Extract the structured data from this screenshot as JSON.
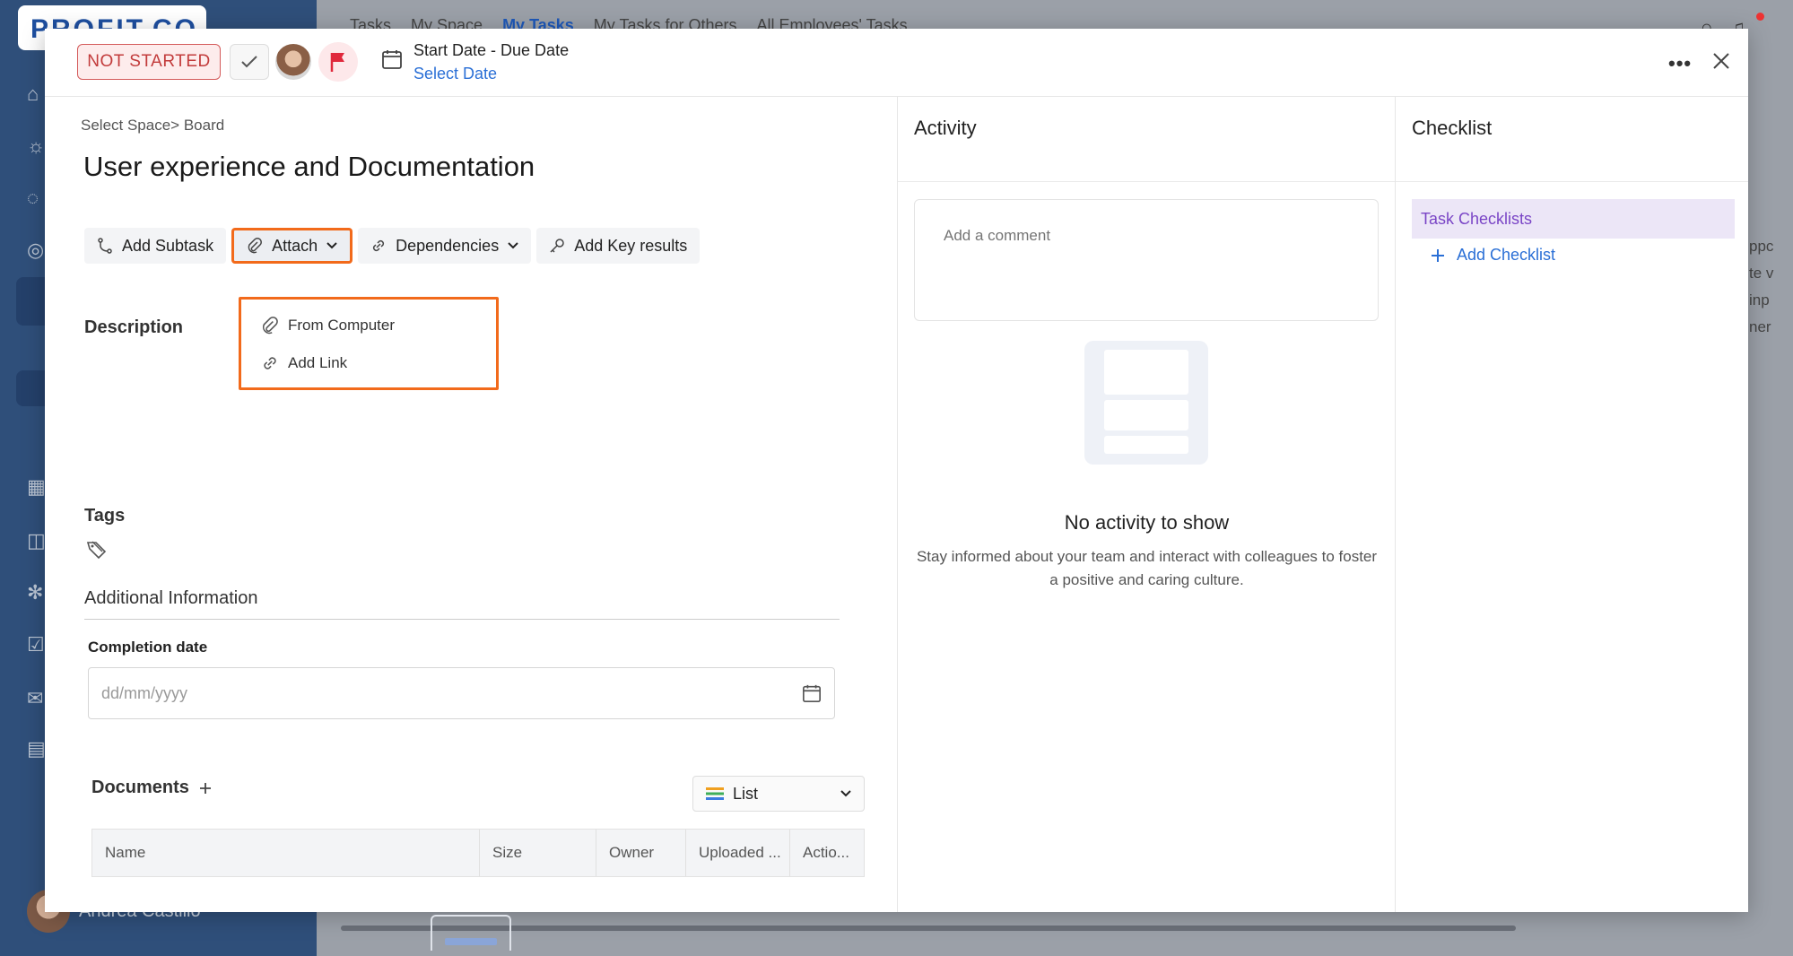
{
  "background": {
    "logo": "PROFIT.CO",
    "nav": [
      "Tasks",
      "My Space",
      "My Tasks",
      "My Tasks for Others",
      "All Employees' Tasks"
    ],
    "user_name": "Andrea Castillo",
    "right_fragments": [
      "ppc",
      "te v",
      "inp",
      "ner"
    ]
  },
  "header": {
    "status": "NOT STARTED",
    "date_title": "Start Date - Due Date",
    "date_link": "Select Date",
    "more": "•••"
  },
  "task": {
    "breadcrumb": "Select Space> Board",
    "title": "User experience and Documentation"
  },
  "toolbar": {
    "add_subtask": "Add Subtask",
    "attach": "Attach",
    "dependencies": "Dependencies",
    "add_key_results": "Add Key results"
  },
  "attach_menu": {
    "from_computer": "From Computer",
    "add_link": "Add Link"
  },
  "sections": {
    "description": "Description",
    "tags": "Tags",
    "additional_info": "Additional Information",
    "completion_date": "Completion date",
    "completion_placeholder": "dd/mm/yyyy",
    "documents": "Documents",
    "view_mode": "List",
    "doc_columns": [
      "Name",
      "Size",
      "Owner",
      "Uploaded ...",
      "Actio..."
    ]
  },
  "activity": {
    "title": "Activity",
    "comment_placeholder": "Add a comment",
    "empty_title": "No activity to show",
    "empty_sub": "Stay informed about your team and interact with colleagues to foster a positive and caring culture."
  },
  "checklist": {
    "title": "Checklist",
    "active_item": "Task Checklists",
    "add_label": "Add Checklist"
  },
  "colors": {
    "highlight": "#f26a1b",
    "link": "#2a6fd6",
    "status_red": "#c23b3b",
    "checklist_purple": "#7a45c6"
  }
}
